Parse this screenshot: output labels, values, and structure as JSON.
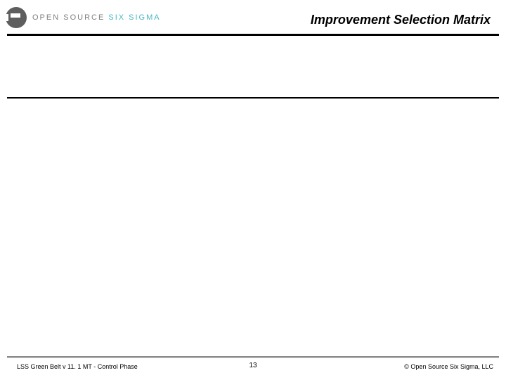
{
  "header": {
    "brand_primary": "OPEN SOURCE",
    "brand_accent": "SIX SIGMA",
    "slide_title": "Improvement Selection Matrix"
  },
  "footer": {
    "left": "LSS Green Belt v 11. 1 MT - Control Phase",
    "page_number": "13",
    "right": "©  Open Source Six Sigma, LLC"
  }
}
